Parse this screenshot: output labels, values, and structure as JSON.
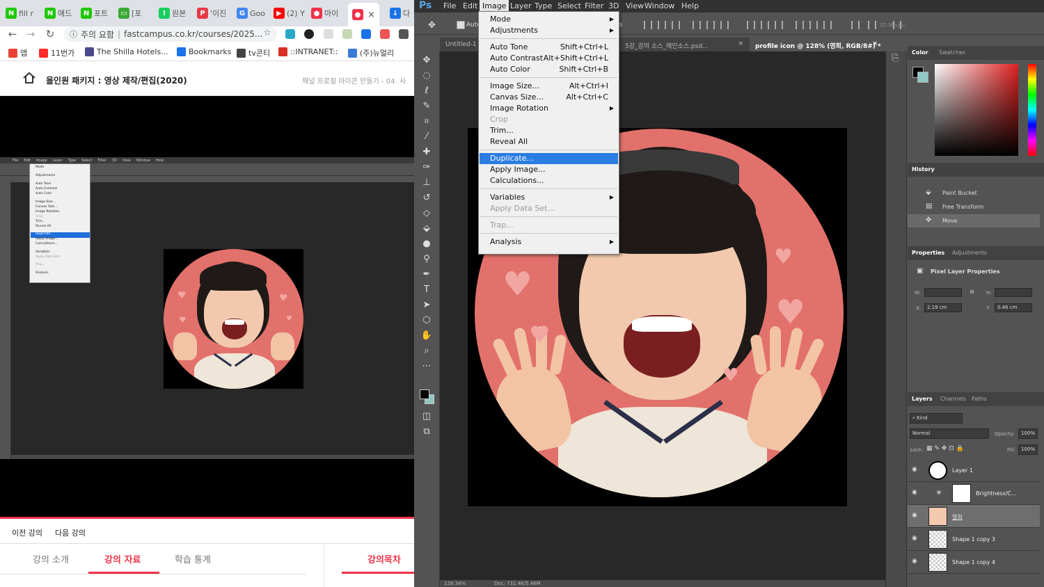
{
  "browser": {
    "tabs": [
      {
        "icon_text": "N",
        "label": "fill r",
        "color": "#1ec800"
      },
      {
        "icon_text": "N",
        "label": "애드",
        "color": "#1ec800"
      },
      {
        "icon_text": "N",
        "label": "포트",
        "color": "#1ec800"
      },
      {
        "icon_text": "▭",
        "label": "[포",
        "color": "#3aa935"
      },
      {
        "icon_text": "!",
        "label": "원본",
        "color": "#19ce60"
      },
      {
        "icon_text": "P",
        "label": "'이진",
        "color": "#e63946"
      },
      {
        "icon_text": "G",
        "label": "Goo",
        "color": "#4285f4"
      },
      {
        "icon_text": "▶",
        "label": "(2) Y",
        "color": "#ff0000"
      },
      {
        "icon_text": "●",
        "label": "마이",
        "color": "#f0324a"
      },
      {
        "icon_text": "●",
        "label": "",
        "color": "#f0324a"
      },
      {
        "icon_text": "↓",
        "label": "다",
        "color": "#1a73e8"
      }
    ],
    "omnibox": {
      "security": "주의 요함",
      "url": "fastcampus.co.kr/courses/2025..."
    },
    "bookmarks": [
      {
        "label": "앱",
        "color": "#ea4335"
      },
      {
        "label": "11번가",
        "color": "#ff2a2a"
      },
      {
        "label": "The Shilla Hotels...",
        "color": "#4a4a8a"
      },
      {
        "label": "Bookmarks",
        "color": "#1a73e8"
      },
      {
        "label": "tv콘티",
        "color": "#444444"
      },
      {
        "label": "::INTRANET::",
        "color": "#d93025"
      },
      {
        "label": "(주)뉴얼리",
        "color": "#3a7bd5"
      }
    ]
  },
  "course": {
    "title": "올인원 패키지 : 영상 제작/편집(2020)",
    "subtitle": "채널 프로필 아이콘 만들기 - 04. 사",
    "prev": "이전 강의",
    "next": "다음 강의",
    "tabs": [
      "강의 소개",
      "강의 자료",
      "학습 통계"
    ],
    "toc": "강의목차"
  },
  "mini": {
    "menu": [
      "File",
      "Edit",
      "Image",
      "Layer",
      "Type",
      "Select",
      "Filter",
      "3D",
      "View",
      "Window",
      "Help"
    ],
    "dropdown": [
      "Mode",
      "Adjustments",
      "Auto Tone",
      "Auto Contrast",
      "Auto Color",
      "Image Size...",
      "Canvas Size...",
      "Image Rotation",
      "Crop",
      "Trim...",
      "Reveal All",
      "Duplicate...",
      "Apply Image...",
      "Calculations...",
      "Variables",
      "Apply Data Set...",
      "Trap...",
      "Analysis"
    ]
  },
  "ps": {
    "logo": "Ps",
    "menu": [
      "File",
      "Edit",
      "Image",
      "Layer",
      "Type",
      "Select",
      "Filter",
      "3D",
      "View",
      "Window",
      "Help"
    ],
    "options": {
      "auto_label": "Auto",
      "ctrl_label": "ls",
      "mode_3d": "3D Mode:"
    },
    "doc_tabs": [
      "Untitled-1",
      "5강_강의 소스_메인소스.psd...",
      "profile icon @ 128% (영희, RGB/8#) *"
    ],
    "image_menu": {
      "groups": [
        [
          {
            "label": "Mode",
            "shortcut": "",
            "sub": true,
            "disabled": false
          },
          {
            "label": "Adjustments",
            "shortcut": "",
            "sub": true,
            "disabled": false
          }
        ],
        [
          {
            "label": "Auto Tone",
            "shortcut": "Shift+Ctrl+L",
            "sub": false,
            "disabled": false
          },
          {
            "label": "Auto Contrast",
            "shortcut": "Alt+Shift+Ctrl+L",
            "sub": false,
            "disabled": false
          },
          {
            "label": "Auto Color",
            "shortcut": "Shift+Ctrl+B",
            "sub": false,
            "disabled": false
          }
        ],
        [
          {
            "label": "Image Size...",
            "shortcut": "Alt+Ctrl+I",
            "sub": false,
            "disabled": false
          },
          {
            "label": "Canvas Size...",
            "shortcut": "Alt+Ctrl+C",
            "sub": false,
            "disabled": false
          },
          {
            "label": "Image Rotation",
            "shortcut": "",
            "sub": true,
            "disabled": false
          },
          {
            "label": "Crop",
            "shortcut": "",
            "sub": false,
            "disabled": true
          },
          {
            "label": "Trim...",
            "shortcut": "",
            "sub": false,
            "disabled": false
          },
          {
            "label": "Reveal All",
            "shortcut": "",
            "sub": false,
            "disabled": false
          }
        ],
        [
          {
            "label": "Duplicate...",
            "shortcut": "",
            "sub": false,
            "disabled": false,
            "highlighted": true
          },
          {
            "label": "Apply Image...",
            "shortcut": "",
            "sub": false,
            "disabled": false
          },
          {
            "label": "Calculations...",
            "shortcut": "",
            "sub": false,
            "disabled": false
          }
        ],
        [
          {
            "label": "Variables",
            "shortcut": "",
            "sub": true,
            "disabled": false
          },
          {
            "label": "Apply Data Set...",
            "shortcut": "",
            "sub": false,
            "disabled": true
          }
        ],
        [
          {
            "label": "Trap...",
            "shortcut": "",
            "sub": false,
            "disabled": true
          }
        ],
        [
          {
            "label": "Analysis",
            "shortcut": "",
            "sub": true,
            "disabled": false
          }
        ]
      ]
    },
    "panels": {
      "color_tabs": [
        "Color",
        "Swatches"
      ],
      "history_title": "History",
      "history": [
        {
          "label": "Paint Bucket",
          "icon": "paint-bucket-icon"
        },
        {
          "label": "Free Transform",
          "icon": "transform-icon"
        },
        {
          "label": "Move",
          "icon": "move-icon"
        }
      ],
      "properties_tabs": [
        "Properties",
        "Adjustments"
      ],
      "properties_title": "Pixel Layer Properties",
      "w_label": "W:",
      "h_label": "H:",
      "x_label": "X:",
      "y_label": "Y:",
      "x_value": "2.19 cm",
      "y_value": "0.46 cm",
      "layers_tabs": [
        "Layers",
        "Channels",
        "Paths"
      ],
      "kind": "Kind",
      "blend": "Normal",
      "opacity_label": "Opacity:",
      "opacity": "100%",
      "lock_label": "Lock:",
      "fill_label": "Fill:",
      "fill": "100%",
      "layers": [
        "Layer 1",
        "Brightness/C...",
        "영희",
        "Shape 1 copy 3",
        "Shape 1 copy 4"
      ]
    },
    "status": {
      "zoom": "128.34%",
      "doc": "Doc: 732.4K/5.46M"
    }
  }
}
